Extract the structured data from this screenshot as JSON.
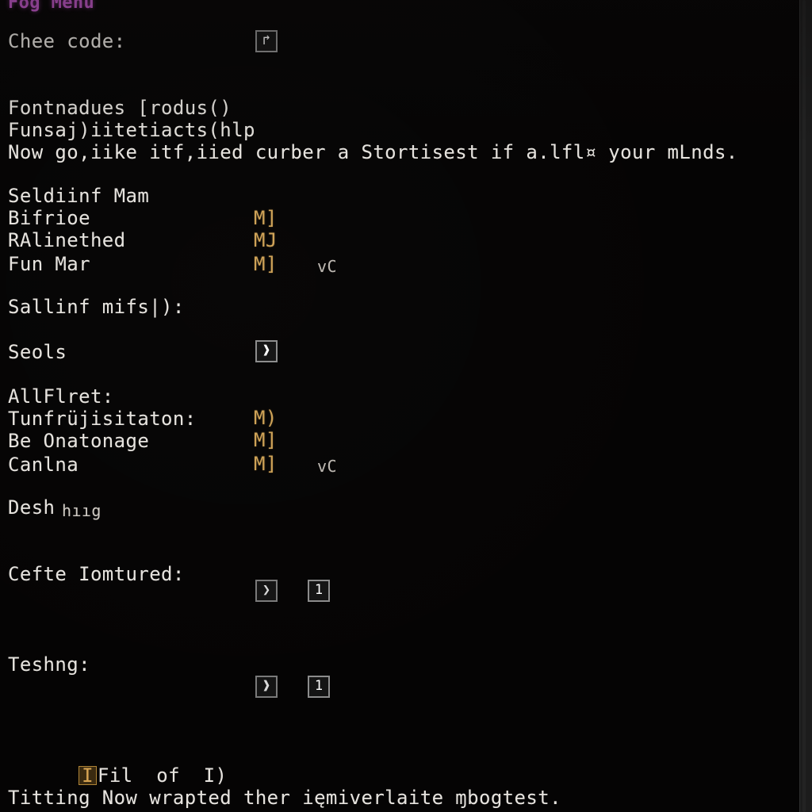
{
  "window": {
    "title": "Fog Menu",
    "background_color": "#050404",
    "accent_color": "#cfa256",
    "title_color": "#c85ad0",
    "text_color": "#e6e3de"
  },
  "sections": {
    "cheat": {
      "label": "Chee code:",
      "widget_glyph": "↱"
    },
    "intro": {
      "line1": "Fontnadues [rodus()",
      "line2": "Funsaj)iitetiacts(hlp",
      "line3": "Now go,iike itf,iied curber a Stortisest if a.lfl¤ your mLnds."
    },
    "group_one": {
      "heading": "Seldiinf Mam",
      "rows": [
        {
          "label": "Bifrioe",
          "marker": "M]",
          "extra": ""
        },
        {
          "label": "RAlinethed",
          "marker": "MJ",
          "extra": ""
        },
        {
          "label": "Fun Mar",
          "marker": "M]",
          "extra": "vC"
        }
      ]
    },
    "calling": {
      "label": "Sallinf mifs|):"
    },
    "seols": {
      "label": "Seols",
      "widget_glyph": "❱"
    },
    "group_two": {
      "heading": "AllFlret:",
      "rows": [
        {
          "label": "Tunfrüjisitaton:",
          "marker": "M)",
          "extra": ""
        },
        {
          "label": "Be Onatonage",
          "marker": "M]",
          "extra": ""
        },
        {
          "label": "Canlna",
          "marker": "M]",
          "extra": "vC"
        }
      ]
    },
    "desh": {
      "label": "Desh",
      "suffix": "hııg"
    },
    "stepper_one": {
      "label": "Cefte Iomtured:",
      "arrow_glyph": "❯",
      "value": "1"
    },
    "stepper_two": {
      "label": "Teshng:",
      "arrow_glyph": "❱",
      "value": "1"
    },
    "footer": {
      "badge": "I",
      "badge_rest": "Fil  of  I)",
      "note": "Titting Now wrapted ther ięmiverlaite ɱbogtest."
    }
  }
}
